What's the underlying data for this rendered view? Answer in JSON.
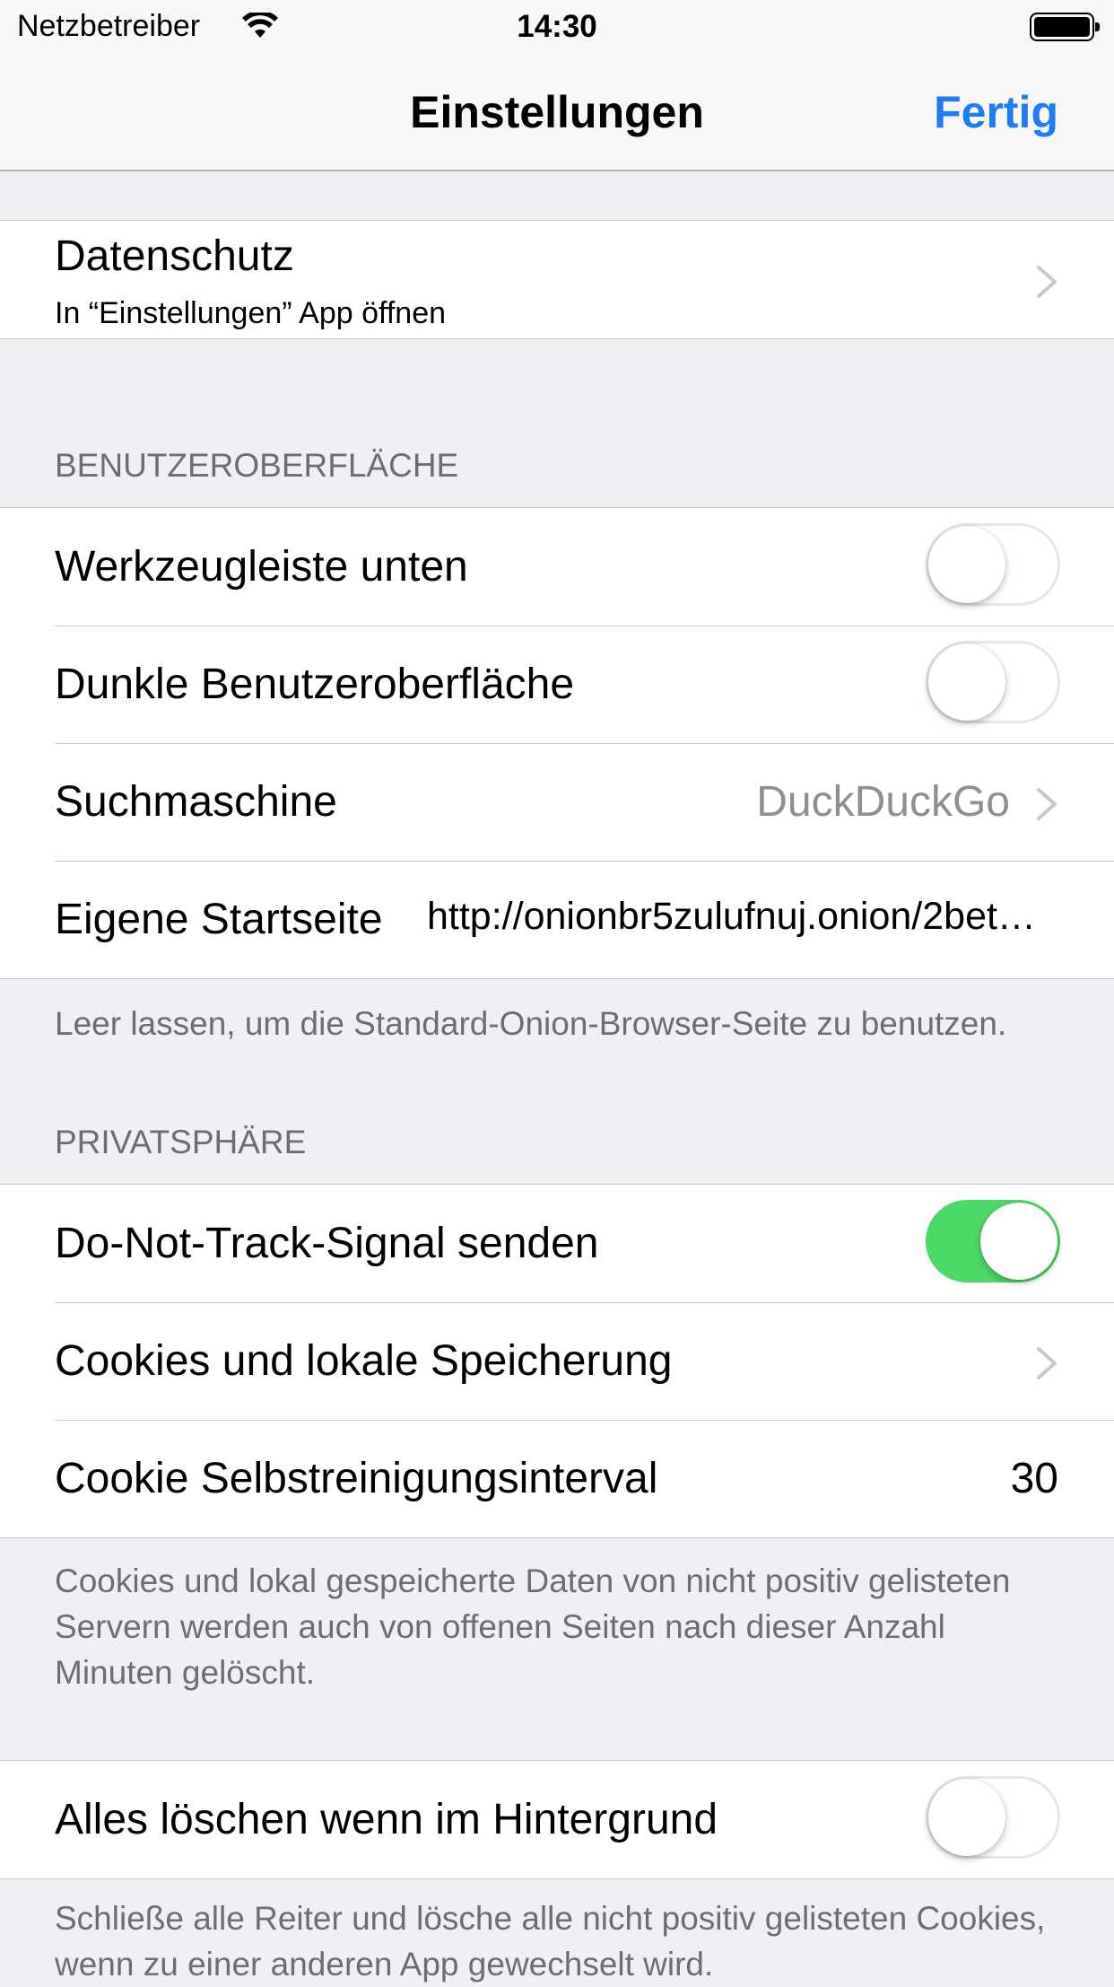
{
  "status_bar": {
    "carrier": "Netzbetreiber",
    "time": "14:30",
    "icons": [
      "wifi-icon",
      "battery-icon"
    ]
  },
  "nav": {
    "title": "Einstellungen",
    "done": "Fertig",
    "accent_color": "#1E7CF5"
  },
  "privacy_link": {
    "title": "Datenschutz",
    "subtitle": "In “Einstellungen” App öffnen"
  },
  "ui_section": {
    "header": "BENUTZEROBERFLÄCHE",
    "toolbar_bottom": {
      "label": "Werkzeugleiste unten",
      "on": false
    },
    "dark_ui": {
      "label": "Dunkle Benutzeroberfläche",
      "on": false
    },
    "search_engine": {
      "label": "Suchmaschine",
      "value": "DuckDuckGo"
    },
    "homepage": {
      "label": "Eigene Startseite",
      "value": "http://onionbr5zulufnuj.onion/2bet…"
    },
    "footer": "Leer lassen, um die Standard-Onion-Browser-Seite zu benutzen."
  },
  "privacy_section": {
    "header": "PRIVATSPHÄRE",
    "dnt": {
      "label": "Do-Not-Track-Signal senden",
      "on": true
    },
    "cookies": {
      "label": "Cookies und lokale Speicherung"
    },
    "cookie_interval": {
      "label": "Cookie Selbstreinigungsinterval",
      "value": "30"
    },
    "footer": "Cookies und lokal gespeicherte Daten von nicht positiv gelisteten Servern werden auch von offenen Seiten nach dieser Anzahl Minuten gelöscht."
  },
  "background_section": {
    "clear_all": {
      "label": "Alles löschen wenn im Hintergrund",
      "on": false
    },
    "footer": "Schließe alle Reiter und lösche alle nicht positiv gelisteten Cookies, wenn zu einer anderen App gewechselt wird."
  },
  "colors": {
    "toggle_on": "#4CD964",
    "background": "#EFEFF4",
    "secondary_text": "#6D6D72"
  }
}
